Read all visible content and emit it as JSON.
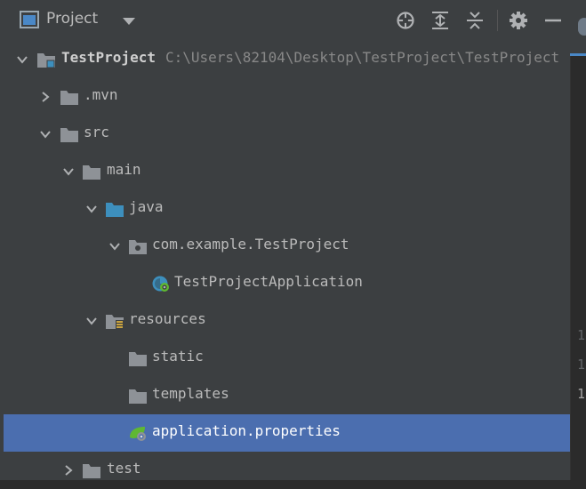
{
  "header": {
    "title": "Project",
    "tools": [
      "locate-icon",
      "expand-all-icon",
      "collapse-all-icon",
      "gear-icon",
      "minimize-icon"
    ]
  },
  "tree": {
    "root": {
      "name": "TestProject",
      "path": "C:\\Users\\82104\\Desktop\\TestProject\\TestProject"
    },
    "mvn": ".mvn",
    "src": "src",
    "main": "main",
    "java": "java",
    "package": "com.example.TestProject",
    "app_class": "TestProjectApplication",
    "resources": "resources",
    "static": "static",
    "templates": "templates",
    "app_properties": "application.properties",
    "test": "test",
    "selected": "application.properties"
  },
  "editor": {
    "gutter": [
      "1",
      "1",
      "1"
    ]
  },
  "colors": {
    "panel_bg": "#3c3f41",
    "selection": "#4b6eaf",
    "folder": "#8e9297",
    "source_folder": "#3d8fbd",
    "spring_green": "#5fb832"
  }
}
